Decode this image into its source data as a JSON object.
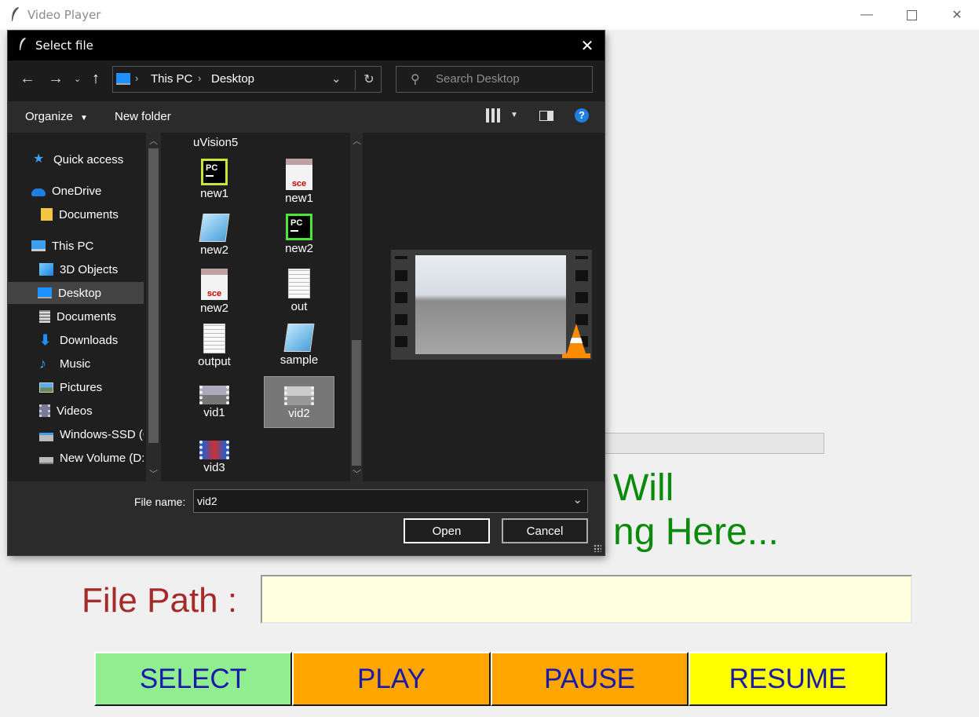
{
  "app": {
    "title": "Video Player",
    "status_line1": "Will",
    "status_line2": "ng Here...",
    "file_path_label": "File Path :",
    "file_path_value": "",
    "buttons": {
      "select": "SELECT",
      "play": "PLAY",
      "pause": "PAUSE",
      "resume": "RESUME"
    },
    "colors": {
      "select_bg": "#90ee90",
      "play_bg": "#ffa500",
      "pause_bg": "#ffa500",
      "resume_bg": "#ffff00",
      "button_text": "#1a1aa8",
      "label": "#a52a2a",
      "status": "#0a8a0a",
      "input_bg": "#ffffe0"
    }
  },
  "dialog": {
    "title": "Select file",
    "address": {
      "segments": [
        "This PC",
        "Desktop"
      ]
    },
    "search_placeholder": "Search Desktop",
    "organize": "Organize",
    "new_folder": "New folder",
    "nav_items": [
      {
        "label": "Quick access",
        "icon": "star-icon"
      },
      {
        "label": "OneDrive",
        "icon": "cloud-icon"
      },
      {
        "label": "Documents",
        "icon": "folder-icon"
      },
      {
        "label": "This PC",
        "icon": "computer-icon"
      },
      {
        "label": "3D Objects",
        "icon": "cube-icon"
      },
      {
        "label": "Desktop",
        "icon": "desktop-icon",
        "selected": true
      },
      {
        "label": "Documents",
        "icon": "document-icon"
      },
      {
        "label": "Downloads",
        "icon": "download-arrow-icon"
      },
      {
        "label": "Music",
        "icon": "music-note-icon"
      },
      {
        "label": "Pictures",
        "icon": "picture-icon"
      },
      {
        "label": "Videos",
        "icon": "film-icon"
      },
      {
        "label": "Windows-SSD (C",
        "icon": "drive-icon"
      },
      {
        "label": "New Volume (D:",
        "icon": "drive-icon"
      }
    ],
    "files_header": "uVision5",
    "files": [
      {
        "name": "new1",
        "icon": "pycharm-icon"
      },
      {
        "name": "new1",
        "icon": "sce-file-icon"
      },
      {
        "name": "new2",
        "icon": "notepad-icon"
      },
      {
        "name": "new2",
        "icon": "pycharm-icon"
      },
      {
        "name": "new2",
        "icon": "sce-file-icon"
      },
      {
        "name": "out",
        "icon": "text-file-icon"
      },
      {
        "name": "output",
        "icon": "text-file-icon"
      },
      {
        "name": "sample",
        "icon": "notepad-icon"
      },
      {
        "name": "vid1",
        "icon": "video-thumb-icon"
      },
      {
        "name": "vid2",
        "icon": "video-thumb-icon",
        "selected": true
      },
      {
        "name": "vid3",
        "icon": "video-thumb-icon"
      }
    ],
    "file_name_label": "File name:",
    "file_name_value": "vid2",
    "open": "Open",
    "cancel": "Cancel"
  }
}
